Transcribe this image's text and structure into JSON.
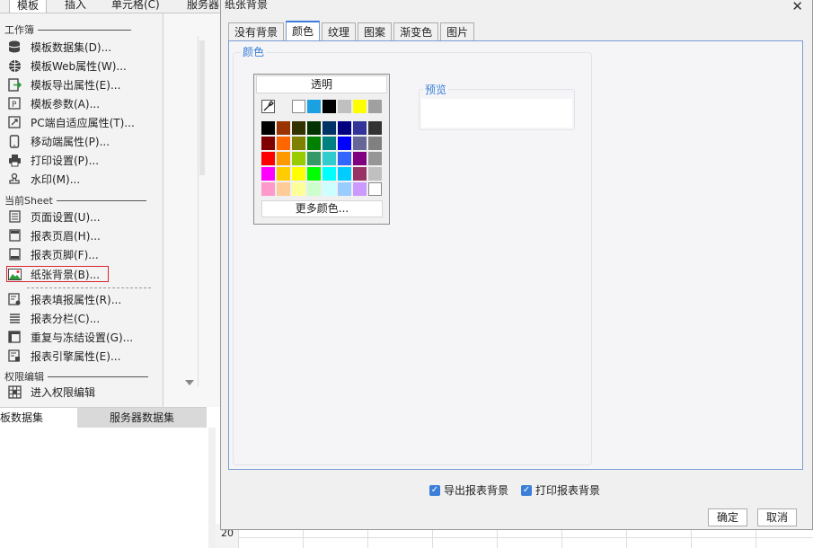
{
  "menubar": {
    "items": [
      "模板",
      "插入",
      "单元格(C)",
      "服务器"
    ]
  },
  "left_panel": {
    "section_workbook": "工作簿",
    "workbook_items": [
      {
        "label": "模板数据集(D)...",
        "icon": "database-icon"
      },
      {
        "label": "模板Web属性(W)...",
        "icon": "globe-icon"
      },
      {
        "label": "模板导出属性(E)...",
        "icon": "export-icon"
      },
      {
        "label": "模板参数(A)...",
        "icon": "parameter-icon"
      },
      {
        "label": "PC端自适应属性(T)...",
        "icon": "resize-icon"
      },
      {
        "label": "移动端属性(P)...",
        "icon": "mobile-icon"
      },
      {
        "label": "打印设置(P)...",
        "icon": "printer-icon"
      },
      {
        "label": "水印(M)...",
        "icon": "stamp-icon"
      }
    ],
    "section_sheet": "当前Sheet",
    "sheet_items": [
      {
        "label": "页面设置(U)...",
        "icon": "page-setup-icon"
      },
      {
        "label": "报表页眉(H)...",
        "icon": "header-icon"
      },
      {
        "label": "报表页脚(F)...",
        "icon": "footer-icon"
      },
      {
        "label": "纸张背景(B)...",
        "icon": "picture-icon"
      }
    ],
    "sheet_items2": [
      {
        "label": "报表填报属性(R)...",
        "icon": "form-fill-icon"
      },
      {
        "label": "报表分栏(C)...",
        "icon": "columns-icon"
      },
      {
        "label": "重复与冻结设置(G)...",
        "icon": "freeze-icon"
      },
      {
        "label": "报表引擎属性(E)...",
        "icon": "engine-icon"
      }
    ],
    "section_permission": "权限编辑",
    "permission_items": [
      {
        "label": "进入权限编辑",
        "icon": "permission-grid-icon"
      }
    ]
  },
  "bottom_tabs": [
    "板数据集",
    "服务器数据集"
  ],
  "row_number": "20",
  "dialog": {
    "title": "纸张背景",
    "close_glyph": "✕",
    "tabs": [
      "没有背景",
      "颜色",
      "纹理",
      "图案",
      "渐变色",
      "图片"
    ],
    "active_tab": 1,
    "color_group_label": "颜色",
    "transparent_label": "透明",
    "more_colors_label": "更多颜色...",
    "preview_label": "预览",
    "export_bg_label": "导出报表背景",
    "print_bg_label": "打印报表背景",
    "ok_label": "确定",
    "cancel_label": "取消",
    "recent_colors": [
      "#ffffff",
      "#1ba1e2",
      "#000000",
      "#c0c0c0",
      "#ffff00",
      "#a0a0a0"
    ],
    "palette": [
      [
        "#000000",
        "#993300",
        "#333300",
        "#003300",
        "#003366",
        "#000080",
        "#333399",
        "#333333"
      ],
      [
        "#800000",
        "#ff6600",
        "#808000",
        "#008000",
        "#008080",
        "#0000ff",
        "#666699",
        "#808080"
      ],
      [
        "#ff0000",
        "#ff9900",
        "#99cc00",
        "#339966",
        "#33cccc",
        "#3366ff",
        "#800080",
        "#969696"
      ],
      [
        "#ff00ff",
        "#ffcc00",
        "#ffff00",
        "#00ff00",
        "#00ffff",
        "#00ccff",
        "#993366",
        "#c0c0c0"
      ],
      [
        "#ff99cc",
        "#ffcc99",
        "#ffff99",
        "#ccffcc",
        "#ccffff",
        "#99ccff",
        "#cc99ff",
        "#ffffff"
      ]
    ]
  }
}
